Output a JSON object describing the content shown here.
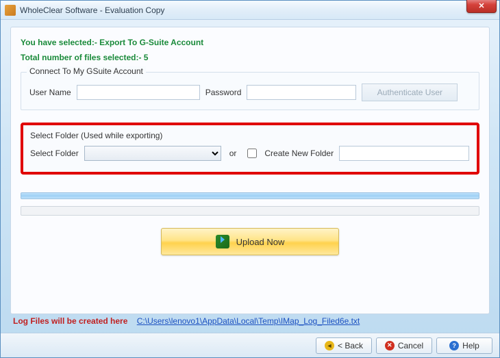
{
  "window": {
    "title": "WholeClear Software - Evaluation Copy"
  },
  "info": {
    "selected_line": "You have selected:- Export To G-Suite Account",
    "total_files_line": "Total number of files selected:- 5"
  },
  "connect": {
    "legend": "Connect To My GSuite Account",
    "username_label": "User Name",
    "username_value": "",
    "password_label": "Password",
    "password_value": "",
    "auth_button": "Authenticate User"
  },
  "folder": {
    "legend": "Select Folder (Used while exporting)",
    "select_label": "Select Folder",
    "combo_value": "",
    "or_text": "or",
    "create_checkbox_label": "Create New Folder",
    "create_checked": false,
    "new_folder_value": ""
  },
  "upload": {
    "button_label": "Upload Now"
  },
  "log": {
    "label": "Log Files will be created here",
    "path": "C:\\Users\\lenovo1\\AppData\\Local\\Temp\\IMap_Log_Filed6e.txt"
  },
  "footer": {
    "back": "< Back",
    "cancel": "Cancel",
    "help": "Help"
  }
}
